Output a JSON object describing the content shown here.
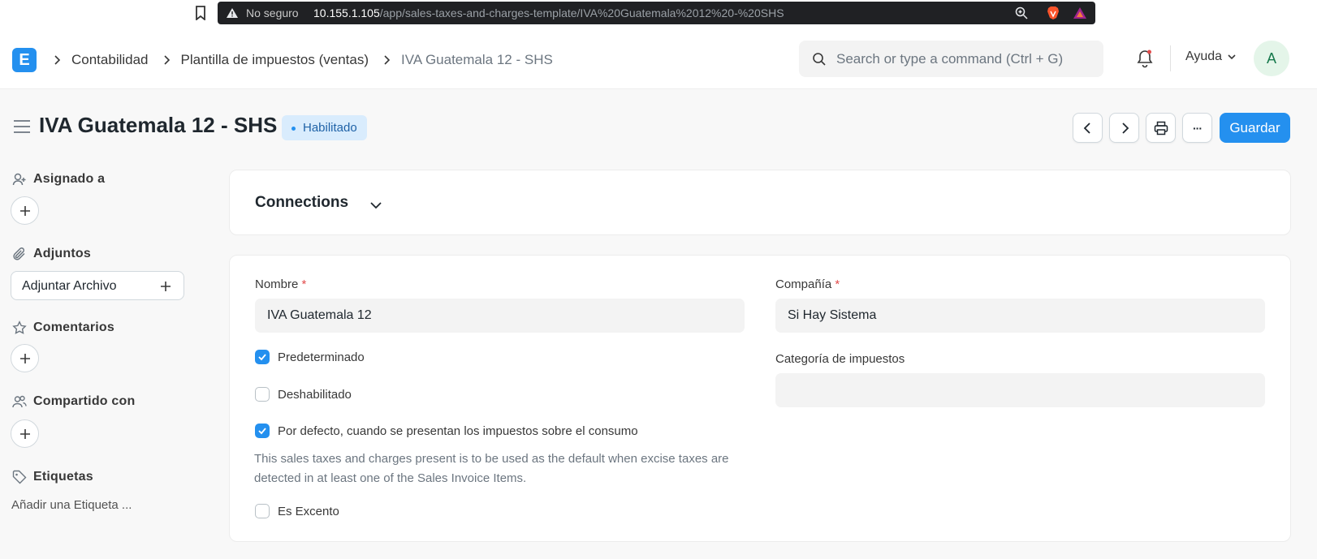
{
  "browser": {
    "security_label": "No seguro",
    "url_host": "10.155.1.105",
    "url_path": "/app/sales-taxes-and-charges-template/IVA%20Guatemala%2012%20-%20SHS"
  },
  "navbar": {
    "logo_letter": "E",
    "breadcrumbs": [
      "Contabilidad",
      "Plantilla de impuestos (ventas)",
      "IVA Guatemala 12 - SHS"
    ],
    "search_placeholder": "Search or type a command (Ctrl + G)",
    "help_label": "Ayuda",
    "avatar_initial": "A"
  },
  "page": {
    "title": "IVA Guatemala 12 - SHS",
    "status_badge": "Habilitado",
    "save_label": "Guardar",
    "more_label": "···"
  },
  "sidebar": {
    "assigned_label": "Asignado a",
    "attachments_label": "Adjuntos",
    "attach_button": "Adjuntar Archivo",
    "comments_label": "Comentarios",
    "shared_label": "Compartido con",
    "tags_label": "Etiquetas",
    "add_tag": "Añadir una Etiqueta ..."
  },
  "connections": {
    "title": "Connections"
  },
  "form": {
    "name_label": "Nombre",
    "name_value": "IVA Guatemala 12",
    "company_label": "Compañía",
    "company_value": "Si Hay Sistema",
    "tax_category_label": "Categoría de impuestos",
    "tax_category_value": "",
    "required_mark": "*",
    "checkboxes": [
      {
        "label": "Predeterminado",
        "checked": true
      },
      {
        "label": "Deshabilitado",
        "checked": false
      },
      {
        "label": "Por defecto, cuando se presentan los impuestos sobre el consumo",
        "checked": true
      },
      {
        "label": "Es Excento",
        "checked": false
      }
    ],
    "excise_description": "This sales taxes and charges present is to be used as the default when excise taxes are detected in at least one of the Sales Invoice Items."
  },
  "colors": {
    "primary": "#2490ef",
    "badge_bg": "#d9ecfd",
    "badge_text": "#1f62a7"
  }
}
